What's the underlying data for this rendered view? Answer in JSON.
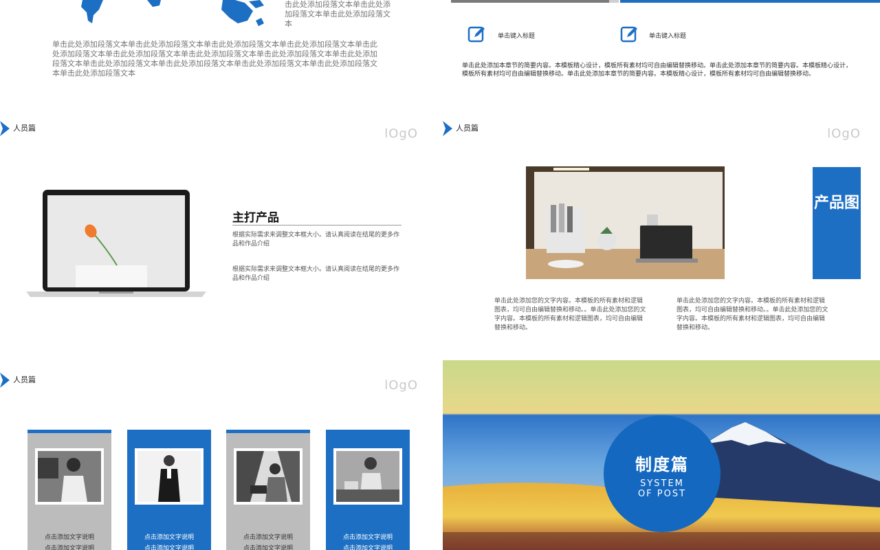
{
  "slide1": {
    "side_text": "击此处添加段落文本单击此处添加段落文本单击此处添加段落文本",
    "paragraph": "单击此处添加段落文本单击此处添加段落文本单击此处添加段落文本单击此处添加段落文本单击此处添加段落文本单击此处添加段落文本单击此处添加段落文本单击此处添加段落文本单击此处添加段落文本单击此处添加段落文本单击此处添加段落文本单击此处添加段落文本单击此处添加段落文本单击此处添加段落文本"
  },
  "slide2": {
    "heading1": "单击键入标题",
    "heading2": "单击键入标题",
    "body": "单击此处添加本章节的简要内容。本模板精心设计，模板所有素材均可自由编辑替换移动。单击此处添加本章节的简要内容。本模板精心设计，模板所有素材均可自由编辑替换移动。单击此处添加本章节的简要内容。本模板精心设计，模板所有素材均可自由编辑替换移动。"
  },
  "slide3": {
    "section": "人员篇",
    "logo": "lOgO",
    "product_title": "主打产品",
    "desc1": "根据实际需求来调整文本框大小。请认真阅读在结尾的更多作品和作品介绍",
    "desc2": "根据实际需求来调整文本框大小。请认真阅读在结尾的更多作品和作品介绍"
  },
  "slide4": {
    "section": "人员篇",
    "logo": "lOgO",
    "panel_text": "产品图",
    "col1": "单击此处添加您的文字内容。本模板的所有素材和逻辑图表，均可自由编辑替换和移动。。单击此处添加您的文字内容。本模板的所有素材和逻辑图表，均可自由编辑替换和移动。",
    "col2": "单击此处添加您的文字内容。本模板的所有素材和逻辑图表，均可自由编辑替换和移动。。单击此处添加您的文字内容。本模板的所有素材和逻辑图表，均可自由编辑替换和移动。"
  },
  "slide5": {
    "section": "人员篇",
    "logo": "lOgO",
    "cards": [
      {
        "caption": "点击添加文字说明\n点击添加文字说明"
      },
      {
        "caption": "点击添加文字说明\n点击添加文字说明"
      },
      {
        "caption": "点击添加文字说明\n点击添加文字说明"
      },
      {
        "caption": "点击添加文字说明\n点击添加文字说明"
      }
    ]
  },
  "slide6": {
    "title_zh": "制度篇",
    "title_en": "SYSTEM\nOF POST"
  },
  "colors": {
    "accent": "#1d6fc4",
    "card_grey": "#bcbcbc",
    "logo_grey": "#c9c9c9"
  },
  "icons": {
    "section_marker": "chevron-arrow-icon",
    "edit": "edit-pencil-icon"
  }
}
